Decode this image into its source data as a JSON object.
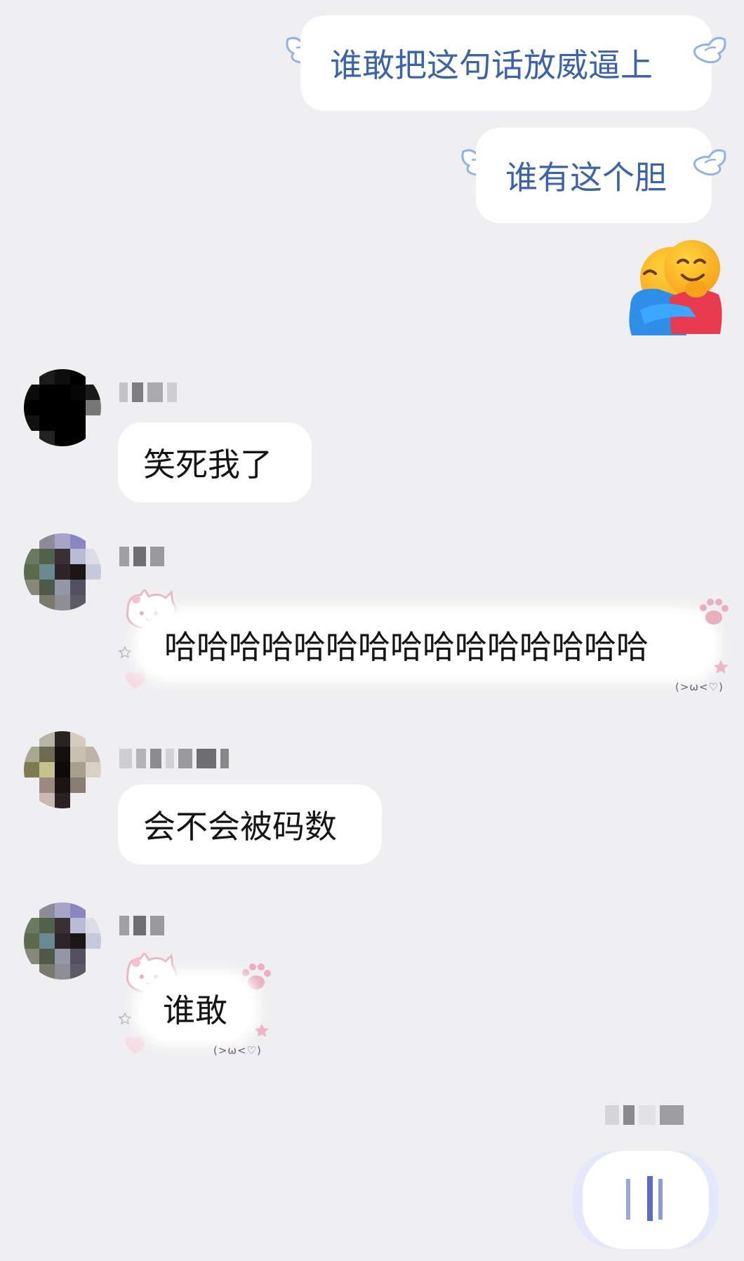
{
  "messages": {
    "outgoing_1": "谁敢把这句话放威逼上",
    "outgoing_2": "谁有这个胆",
    "reply_1": "笑死我了",
    "reply_2": "哈哈哈哈哈哈哈哈哈哈哈哈哈哈哈",
    "reply_3": "会不会被码数",
    "reply_4": "谁敢"
  },
  "decorations": {
    "kaomoji": "(>ω<♡)"
  },
  "colors": {
    "background": "#efeff1",
    "outgoing_text": "#3a63a8",
    "bubble": "#ffffff",
    "text": "#141414"
  }
}
